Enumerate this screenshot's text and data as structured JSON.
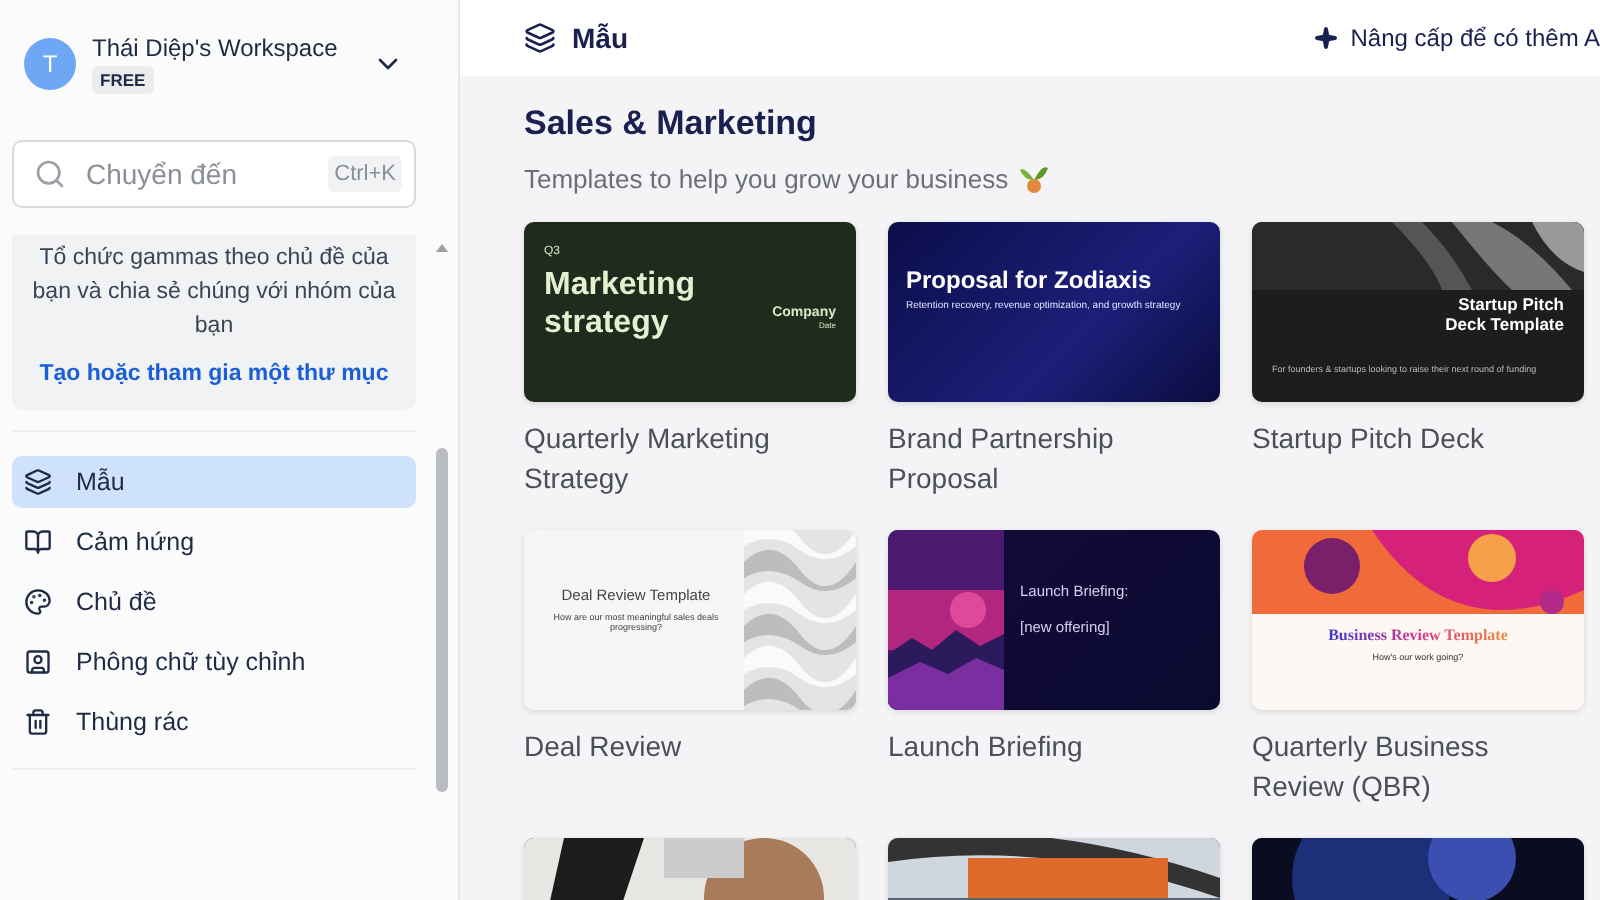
{
  "workspace": {
    "avatar": "T",
    "name": "Thái Diệp's Workspace",
    "plan": "FREE"
  },
  "search": {
    "placeholder": "Chuyển đến",
    "shortcut": "Ctrl+K"
  },
  "folder_card": {
    "text": "Tổ chức gammas theo chủ đề của bạn và chia sẻ chúng với nhóm của bạn",
    "link": "Tạo hoặc tham gia một thư mục"
  },
  "nav": [
    {
      "label": "Mẫu",
      "selected": true
    },
    {
      "label": "Cảm hứng",
      "selected": false
    },
    {
      "label": "Chủ đề",
      "selected": false
    },
    {
      "label": "Phông chữ tùy chỉnh",
      "selected": false
    },
    {
      "label": "Thùng rác",
      "selected": false
    }
  ],
  "header": {
    "title": "Mẫu",
    "upgrade": "Nâng cấp để có thêm A"
  },
  "section": {
    "title": "Sales & Marketing",
    "subtitle": "Templates to help you grow your business"
  },
  "templates": [
    {
      "name": "Quarterly Marketing Strategy",
      "slide": {
        "kind": "green",
        "texts": [
          "Q3",
          "Marketing strategy",
          "Company",
          "Date"
        ]
      }
    },
    {
      "name": "Brand Partnership Proposal",
      "slide": {
        "kind": "proposal",
        "texts": [
          "Proposal for Zodiaxis",
          "Retention recovery, revenue optimization, and growth strategy"
        ]
      }
    },
    {
      "name": "Startup Pitch Deck",
      "slide": {
        "kind": "pitch",
        "texts": [
          "Startup Pitch Deck Template",
          "For founders & startups looking to raise their next round of funding"
        ]
      }
    },
    {
      "name": "Deal Review",
      "slide": {
        "kind": "deal",
        "texts": [
          "Deal Review Template",
          "How are our most meaningful sales deals progressing?"
        ]
      }
    },
    {
      "name": "Launch Briefing",
      "slide": {
        "kind": "launch",
        "texts": [
          "Launch Briefing: [new offering]"
        ]
      }
    },
    {
      "name": "Quarterly Business Review (QBR)",
      "slide": {
        "kind": "business",
        "texts": [
          "Business Review Template",
          "How's our work going?"
        ]
      }
    },
    {
      "slide": {
        "kind": "picture"
      }
    },
    {
      "slide": {
        "kind": "picture"
      }
    },
    {
      "slide": {
        "kind": "picture"
      }
    }
  ]
}
